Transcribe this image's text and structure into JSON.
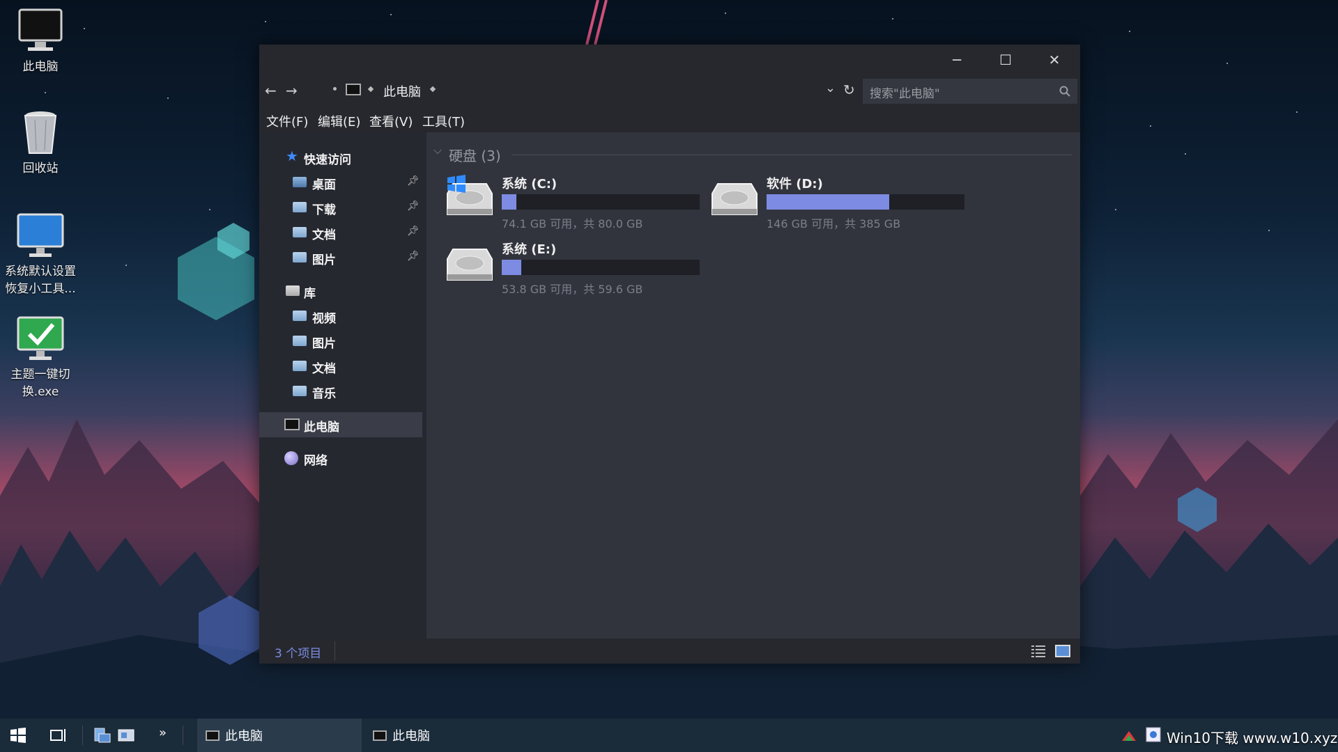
{
  "desktop": {
    "icons": [
      {
        "label": "此电脑",
        "icon": "computer-icon"
      },
      {
        "label": "回收站",
        "icon": "recycle-bin-icon"
      },
      {
        "label": "系统默认设置恢复小工具...",
        "icon": "monitor-icon"
      },
      {
        "label": "主题一键切换.exe",
        "icon": "checkmark-monitor-icon"
      }
    ]
  },
  "window": {
    "controls": {
      "minimize": "─",
      "maximize": "☐",
      "close": "✕"
    },
    "nav": {
      "back": "←",
      "forward": "→"
    },
    "breadcrumb": {
      "location": "此电脑"
    },
    "search": {
      "placeholder": "搜索\"此电脑\""
    },
    "menu": [
      "文件(F)",
      "编辑(E)",
      "查看(V)",
      "工具(T)"
    ],
    "sidebar": {
      "quick_access": "快速访问",
      "quick_items": [
        "桌面",
        "下载",
        "文档",
        "图片"
      ],
      "library": "库",
      "library_items": [
        "视频",
        "图片",
        "文档",
        "音乐"
      ],
      "this_pc": "此电脑",
      "network": "网络"
    },
    "group": {
      "title": "硬盘 (3)"
    },
    "drives": [
      {
        "name": "系统 (C:)",
        "info": "74.1 GB 可用，共 80.0 GB",
        "used_fraction": 0.074,
        "windows_logo": true
      },
      {
        "name": "软件 (D:)",
        "info": "146 GB 可用，共 385 GB",
        "used_fraction": 0.62,
        "windows_logo": false
      },
      {
        "name": "系统 (E:)",
        "info": "53.8 GB 可用，共 59.6 GB",
        "used_fraction": 0.1,
        "windows_logo": false
      }
    ],
    "status": {
      "count": "3 个项目"
    }
  },
  "taskbar": {
    "apps": [
      "此电脑",
      "此电脑"
    ],
    "watermark": "Win10下载 www.w10.xyz"
  },
  "colors": {
    "accent": "#7d8ce2",
    "window_bg": "#2b2d35",
    "sidebar_bg": "#262830"
  }
}
